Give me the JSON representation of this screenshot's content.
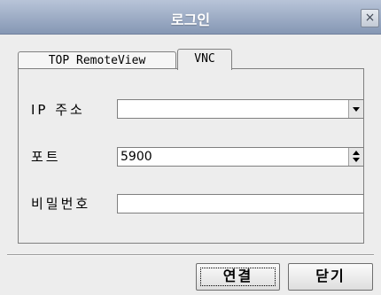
{
  "window": {
    "title": "로그인",
    "close_glyph": "×"
  },
  "tabs": [
    {
      "label": "TOP RemoteView",
      "active": false
    },
    {
      "label": "VNC",
      "active": true
    }
  ],
  "form": {
    "ip_label": "IP 주소",
    "ip_value": "",
    "port_label": "포트",
    "port_value": "5900",
    "password_label": "비밀번호",
    "password_value": ""
  },
  "buttons": {
    "connect": "연결",
    "close": "닫기"
  }
}
